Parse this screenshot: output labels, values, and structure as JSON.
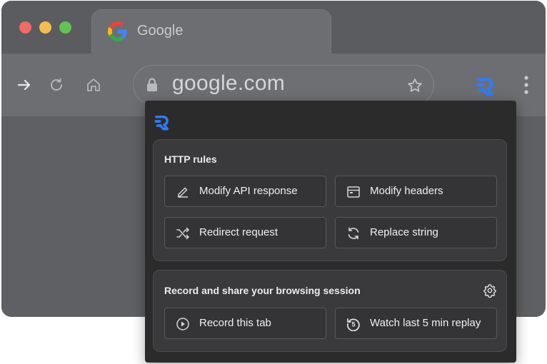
{
  "browser": {
    "tab": {
      "title": "Google",
      "favicon": "google-g-icon"
    },
    "toolbar": {
      "icons": [
        "forward-icon",
        "reload-icon",
        "home-icon",
        "extension-icon",
        "more-icon"
      ],
      "url": "google.com"
    },
    "window_controls": [
      "close",
      "minimize",
      "maximize"
    ]
  },
  "popup": {
    "logo": "requestly-logo",
    "http_rules": {
      "title": "HTTP rules",
      "buttons": [
        {
          "label": "Modify API response",
          "icon": "edit-pencil-icon"
        },
        {
          "label": "Modify headers",
          "icon": "browser-window-icon"
        },
        {
          "label": "Redirect request",
          "icon": "shuffle-icon"
        },
        {
          "label": "Replace string",
          "icon": "refresh-arrows-icon"
        }
      ]
    },
    "session": {
      "title": "Record and share your browsing session",
      "settings_icon": "gear-icon",
      "buttons": [
        {
          "label": "Record this tab",
          "icon": "play-circle-icon"
        },
        {
          "label": "Watch last 5 min replay",
          "icon": "replay-5-icon"
        }
      ]
    }
  },
  "colors": {
    "accent": "#2f7cf6",
    "panel_bg": "#2b2b2c",
    "card_bg": "#3a3a3c"
  }
}
